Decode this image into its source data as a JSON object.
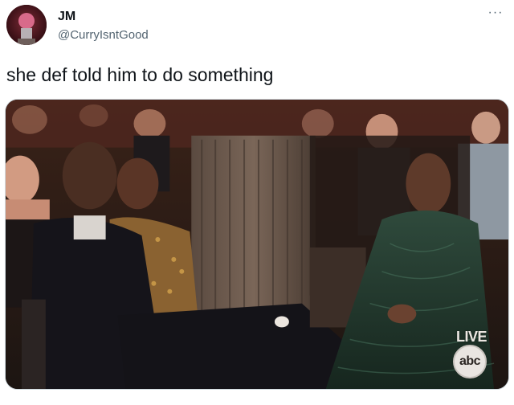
{
  "author": {
    "display_name": "JM",
    "handle": "@CurryIsntGood",
    "avatar_icon": "avatar-image"
  },
  "more_menu": {
    "label": "···",
    "icon": "more-horizontal-icon"
  },
  "tweet": {
    "text": "she def told him to do something"
  },
  "media": {
    "watermark_live": "LIVE",
    "network_logo": "abc"
  }
}
